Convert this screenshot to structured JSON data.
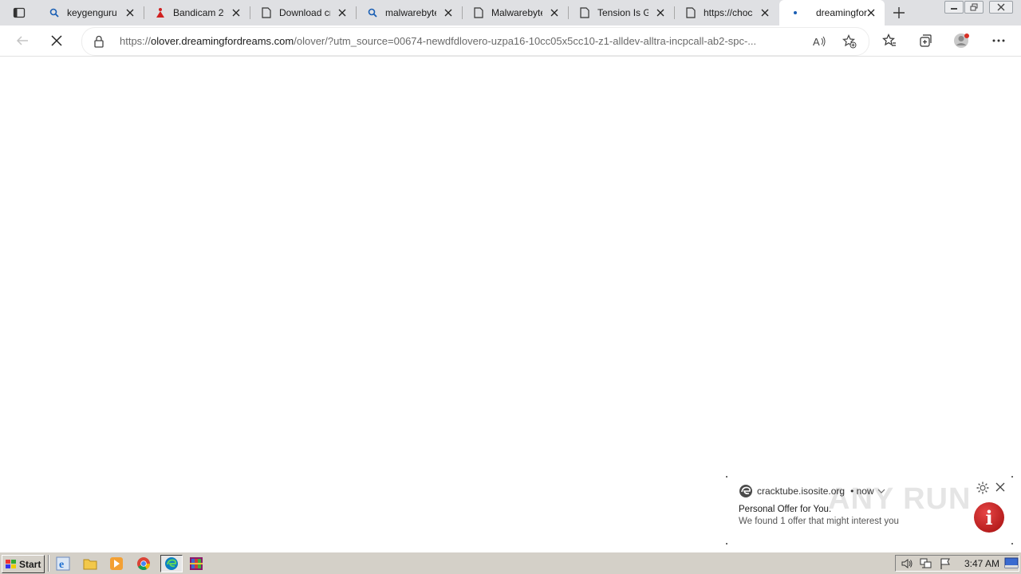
{
  "tabs": [
    {
      "title": "keygenguru",
      "icon": "search-icon"
    },
    {
      "title": "Bandicam 20",
      "icon": "bandicam-icon"
    },
    {
      "title": "Download cr",
      "icon": "page-icon"
    },
    {
      "title": "malwarebyte",
      "icon": "search-icon"
    },
    {
      "title": "Malwarebyte",
      "icon": "page-icon"
    },
    {
      "title": "Tension Is Gr",
      "icon": "page-icon"
    },
    {
      "title": "https://choc",
      "icon": "page-icon"
    },
    {
      "title": "dreamingfor",
      "icon": "loading-dot-icon",
      "active": true
    }
  ],
  "address": {
    "url_prefix": "https://",
    "url_host": "olover.dreamingfordreams.com",
    "url_rest": "/olover/?utm_source=00674-newdfdlovero-uzpa16-10cc05x5cc10-z1-alldev-alltra-incpcall-ab2-spc-..."
  },
  "notification": {
    "site": "cracktube.isosite.org",
    "time": "• now",
    "title": "Personal Offer for You.",
    "body": "We found 1 offer that might interest you",
    "watermark": "ANY RUN"
  },
  "taskbar": {
    "start_label": "Start",
    "clock": "3:47 AM"
  },
  "colors": {
    "tabstrip": "#dfe0e3",
    "taskbar": "#d4d0c8",
    "info_badge": "#c81e1e"
  }
}
